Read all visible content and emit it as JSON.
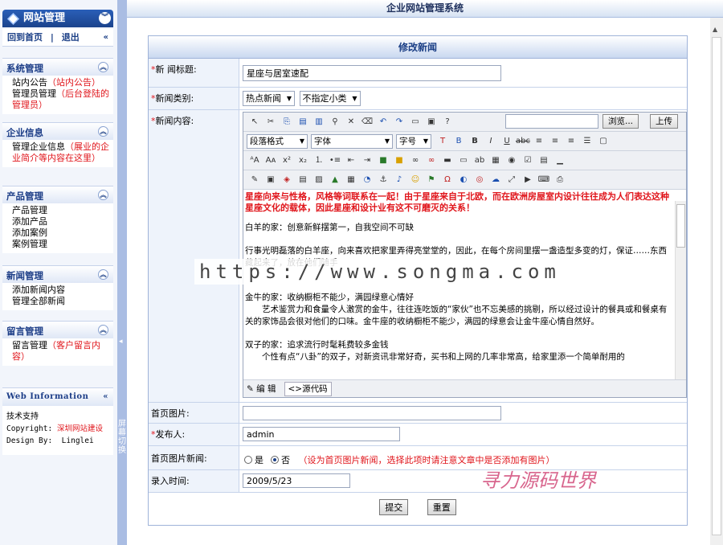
{
  "sidebar": {
    "brand": "网站管理",
    "home": "回到首页",
    "sep": "|",
    "logout": "退出",
    "groups": [
      {
        "title": "系统管理",
        "items": [
          [
            "站内公告",
            "（站内公告）"
          ],
          [
            "管理员管理",
            "（后台登陆的管理员）"
          ]
        ]
      },
      {
        "title": "企业信息",
        "items": [
          [
            "管理企业信息",
            "（展业的企业简介等内容在这里）"
          ]
        ]
      },
      {
        "title": "产品管理",
        "items": [
          [
            "产品管理",
            ""
          ],
          [
            "添加产品",
            ""
          ],
          [
            "添加案例",
            ""
          ],
          [
            "案例管理",
            ""
          ]
        ]
      },
      {
        "title": "新闻管理",
        "items": [
          [
            "添加新闻内容",
            ""
          ],
          [
            "管理全部新闻",
            ""
          ]
        ]
      },
      {
        "title": "留言管理",
        "items": [
          [
            "留言管理",
            "（客户留言内容）"
          ]
        ]
      }
    ],
    "webinfo": {
      "title": "Web Information",
      "support_label": "技术支持",
      "copyright_label": "Copyright:",
      "copyright_value": "深圳网站建设",
      "design_label": "Design By:",
      "design_value": "Linglei"
    },
    "splitter_text": "屏幕切换"
  },
  "header": {
    "title": "企业网站管理系统"
  },
  "form": {
    "caption": "修改新闻",
    "title_label": "新 闻标题:",
    "title_value": "星座与居室速配",
    "category_label": "新闻类别:",
    "category_main": "热点新闻",
    "category_sub": "不指定小类",
    "content_label": "新闻内容:",
    "editor": {
      "browse": "浏览...",
      "upload": "上传",
      "para_format": "段落格式",
      "font": "字体",
      "font_size": "字号",
      "mode_edit": "编 辑",
      "mode_source": "源代码",
      "content": {
        "headline": "星座向来与性格，风格等词联系在一起！由于星座来自于北欧，而在欧洲房屋室内设计往往成为人们表达这种星座文化的载体，因此星座和设计业有这不可磨灭的关系！",
        "p1": "白羊的家：创意新鲜摆第一，自我空间不可缺",
        "p2": "行事光明磊落的白羊座，向来喜欢把家里弄得亮堂堂的，因此，在每个房间里摆一盏造型多变的灯，保证……东西藏起来了，放在他们随手",
        "p3": "金牛的家：收纳橱柜不能少，满园绿意心情好",
        "p4": "艺术鉴赏力和食量令人激赏的金牛，往往连吃饭的“家伙”也不忘美感的挑剔，所以经过设计的餐具或和餐桌有关的家饰品会很对他们的口味。金牛座的收纳橱柜不能少，满园的绿意会让金牛座心情自然好。",
        "p5": "双子的家：追求流行时髦耗费较多金钱",
        "p6": "个性有点“八卦”的双子，对新资讯非常好奇，买书和上网的几率非常高，给家里添一个简单耐用的"
      }
    },
    "image_label": "首页图片:",
    "image_value": "",
    "publisher_label": "发布人:",
    "publisher_value": "admin",
    "img_news_label": "首页图片新闻:",
    "opt_yes": "是",
    "opt_no": "否",
    "img_news_note": "（设为首页图片新闻，选择此项时请注意文章中是否添加有图片）",
    "time_label": "录入时间:",
    "time_value": "2009/5/23",
    "submit": "提交",
    "reset": "重置"
  },
  "watermark": "https://www.songma.com",
  "watermark2": "寻力源码世界"
}
